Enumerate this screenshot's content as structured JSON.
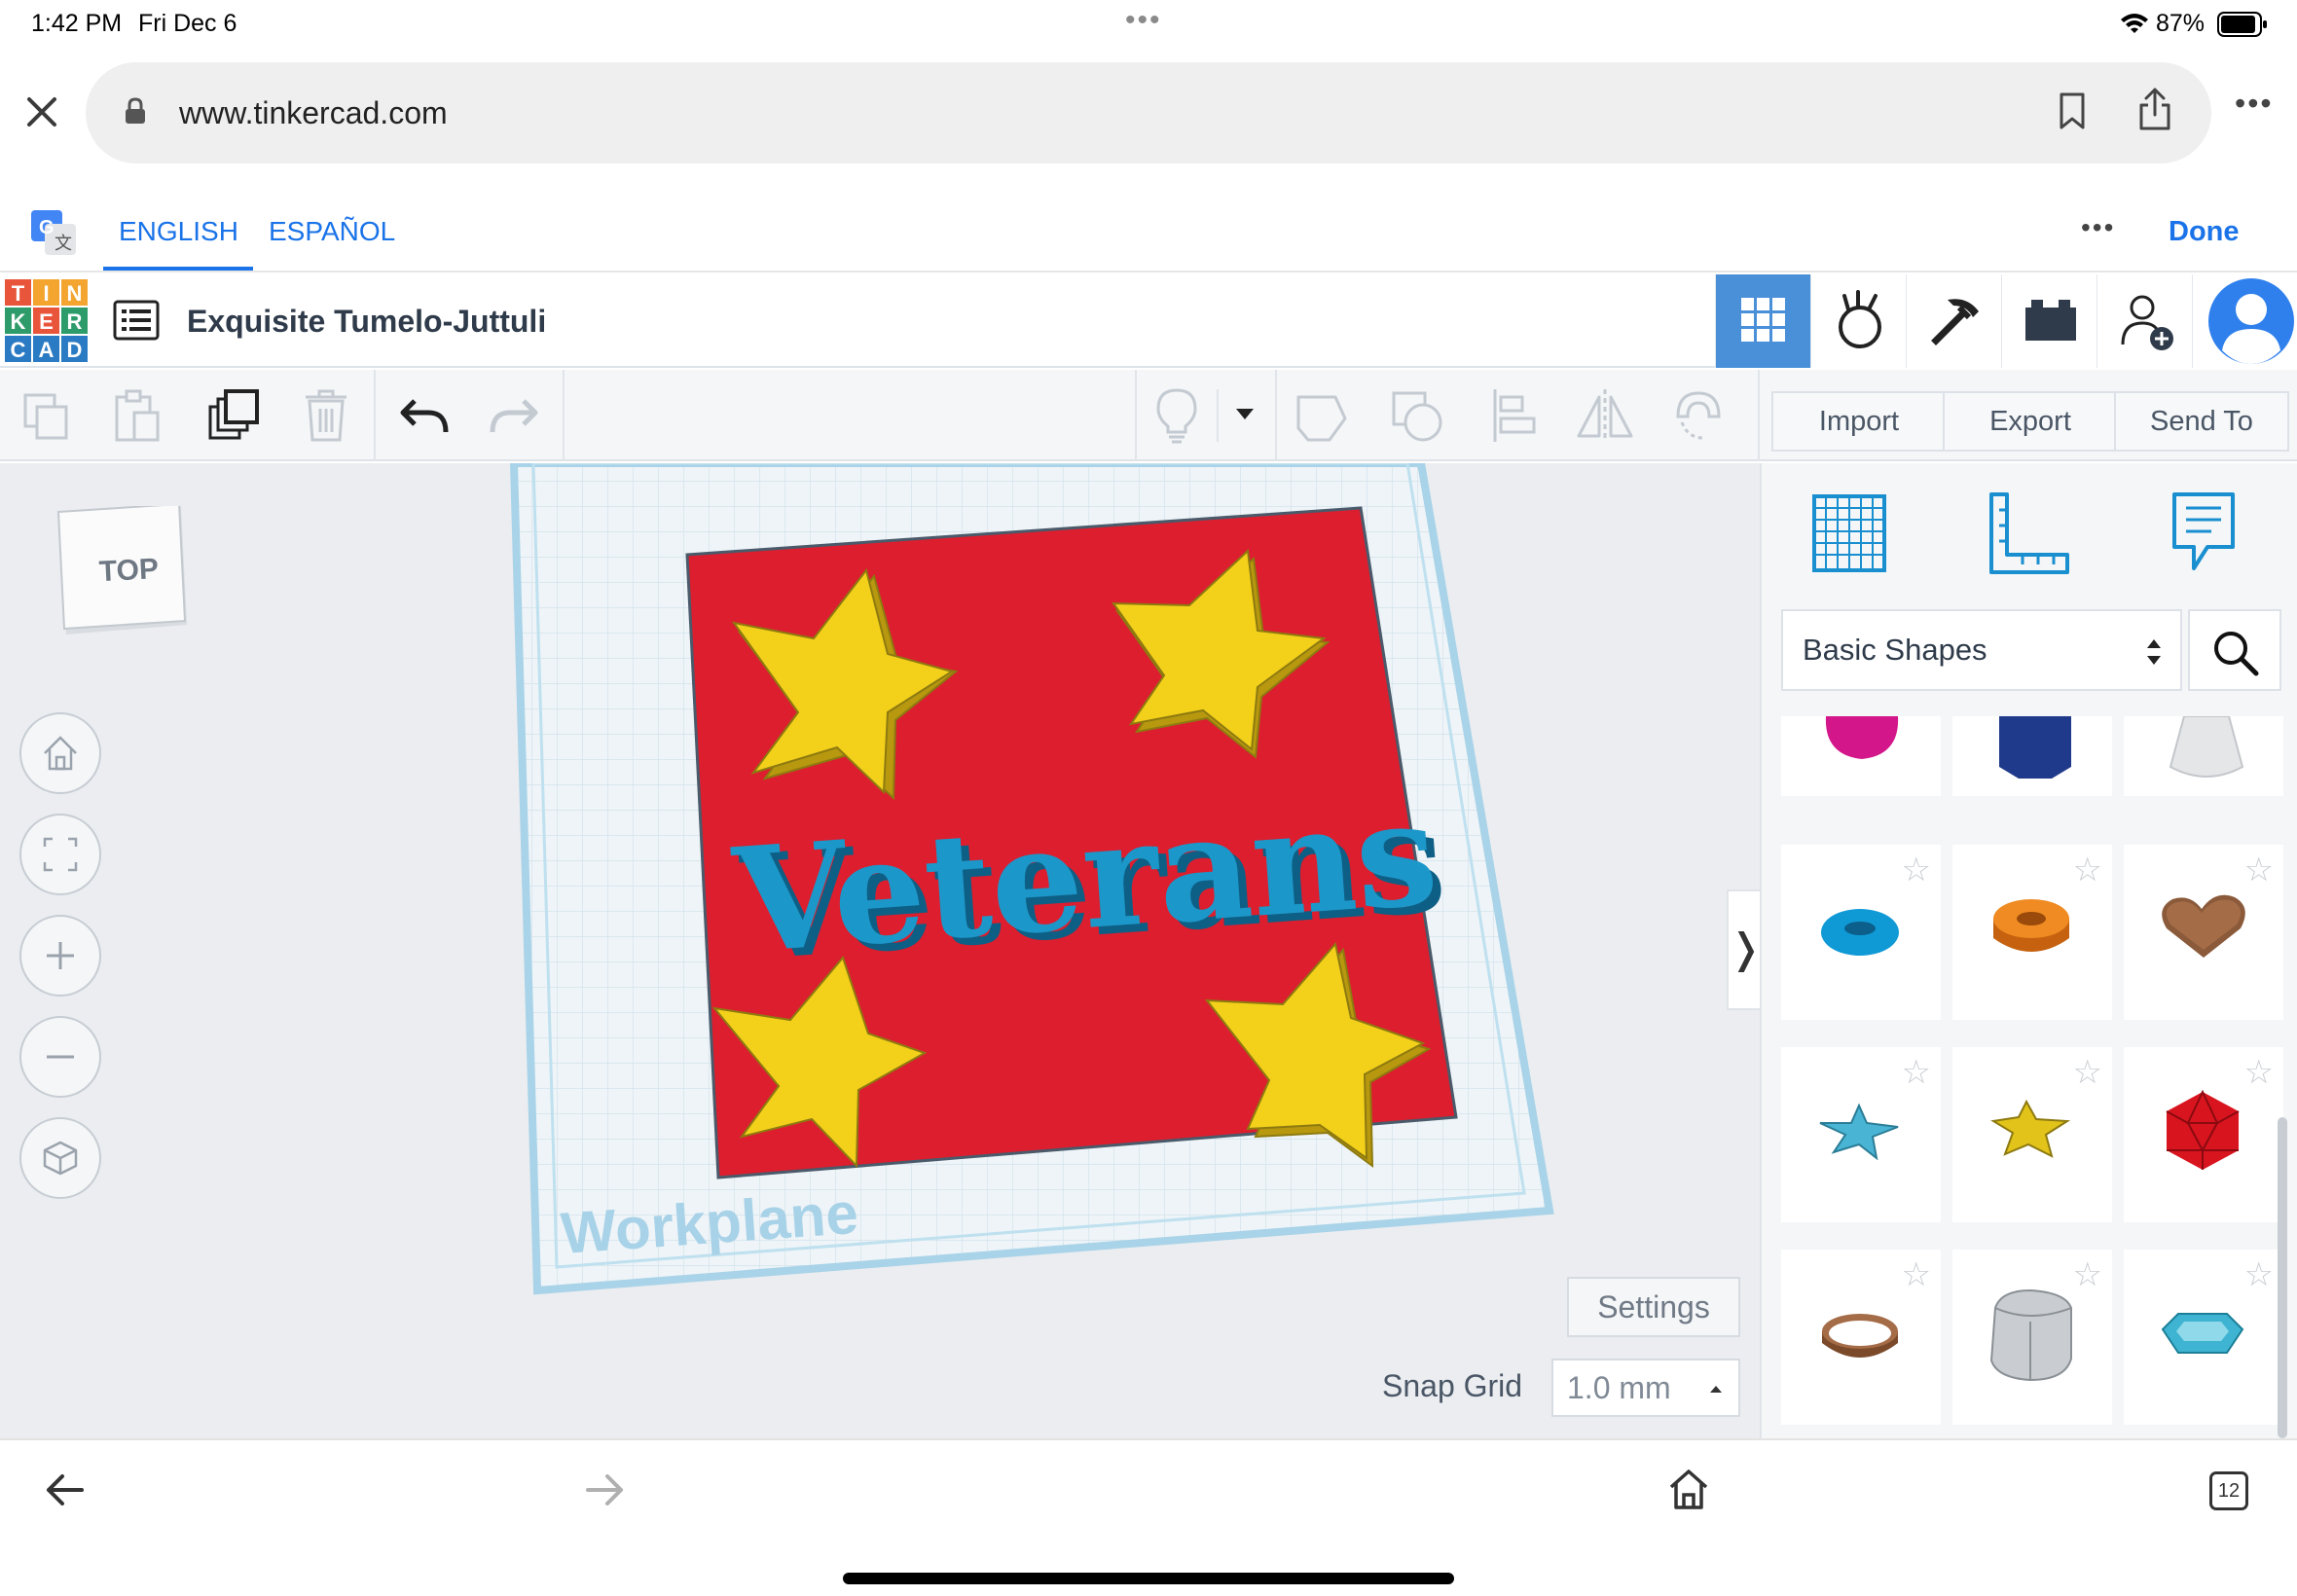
{
  "status_bar": {
    "time": "1:42 PM",
    "date": "Fri Dec 6",
    "battery": "87%"
  },
  "browser": {
    "url": "www.tinkercad.com"
  },
  "translate": {
    "lang_english": "ENGLISH",
    "lang_spanish": "ESPAÑOL",
    "done": "Done"
  },
  "app": {
    "logo_letters": [
      "T",
      "I",
      "N",
      "K",
      "E",
      "R",
      "C",
      "A",
      "D"
    ],
    "doc_title": "Exquisite Tumelo-Juttuli"
  },
  "toolbar": {
    "import": "Import",
    "export": "Export",
    "send_to": "Send To"
  },
  "viewcube": {
    "face": "TOP"
  },
  "scene": {
    "text_object": "Veterans",
    "workplane_label": "Workplane"
  },
  "workspace": {
    "settings": "Settings",
    "snap_grid_label": "Snap Grid",
    "snap_grid_value": "1.0 mm"
  },
  "shapes_panel": {
    "category": "Basic Shapes",
    "shapes": [
      "paraboloid-magenta",
      "polygon-navy",
      "cone-white",
      "torus-blue",
      "tube-orange",
      "heart-brown",
      "star-teal",
      "star-yellow",
      "icosahedron-red",
      "ring-brown",
      "rounded-cube-gray",
      "gem-cyan"
    ]
  },
  "tabs_count": "12",
  "colors": {
    "accent": "#4a90d9",
    "browser_blue": "#1a73e8",
    "base_red": "#dc1e2e",
    "star_yellow": "#f3d01a",
    "text_blue": "#1c97c9"
  }
}
